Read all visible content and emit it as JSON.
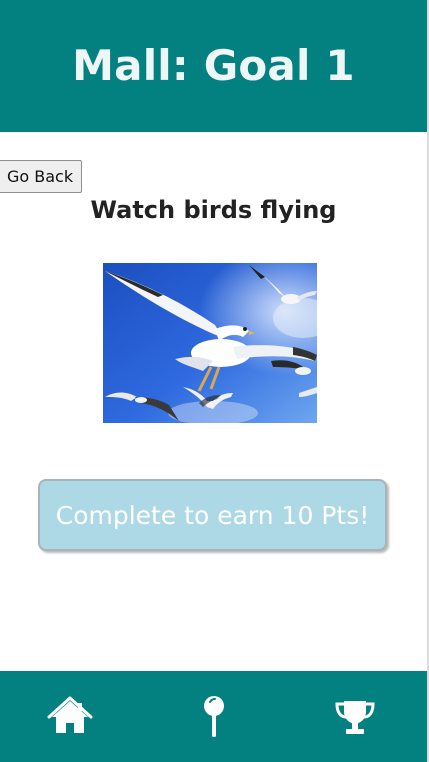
{
  "header": {
    "title": "Mall: Goal 1"
  },
  "toolbar": {
    "back_label": "Go Back"
  },
  "goal": {
    "title": "Watch birds flying",
    "image_icon": "seagulls-photo",
    "complete_label": "Complete to earn 10 Pts!"
  },
  "nav": {
    "items": [
      {
        "icon": "home-icon"
      },
      {
        "icon": "map-pin-icon"
      },
      {
        "icon": "trophy-icon"
      }
    ]
  },
  "colors": {
    "brand": "#038180",
    "button_bg": "#add8e6",
    "button_text": "#ffffff"
  }
}
